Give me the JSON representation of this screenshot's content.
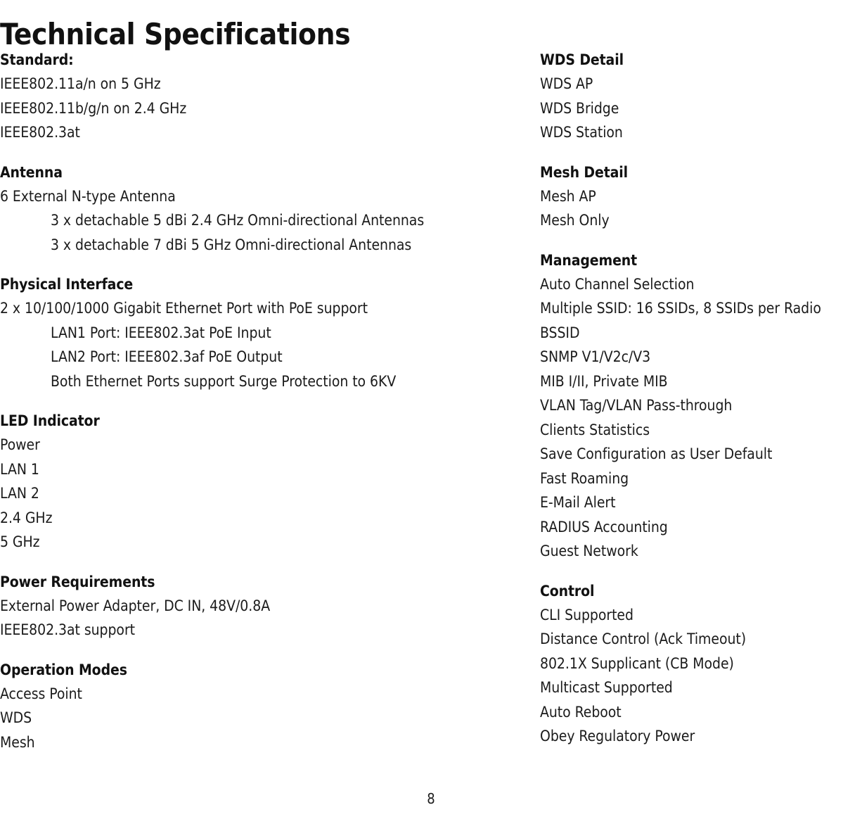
{
  "document": {
    "title": "Technical Specifications",
    "page_number": "8"
  },
  "left_column": {
    "sections": [
      {
        "heading": "Standard:",
        "items": [
          {
            "text": "IEEE802.11a/n on 5 GHz",
            "indent": false
          },
          {
            "text": "IEEE802.11b/g/n on 2.4 GHz",
            "indent": false
          },
          {
            "text": "IEEE802.3at",
            "indent": false
          }
        ]
      },
      {
        "heading": "Antenna",
        "items": [
          {
            "text": "6 External N-type Antenna",
            "indent": false
          },
          {
            "text": "3 x detachable 5 dBi 2.4 GHz Omni-directional Antennas",
            "indent": true
          },
          {
            "text": "3 x detachable 7 dBi 5 GHz Omni-directional Antennas",
            "indent": true
          }
        ]
      },
      {
        "heading": "Physical Interface",
        "items": [
          {
            "text": "2 x 10/100/1000 Gigabit Ethernet Port with PoE support",
            "indent": false
          },
          {
            "text": "LAN1 Port: IEEE802.3at PoE Input",
            "indent": true
          },
          {
            "text": "LAN2 Port: IEEE802.3af PoE Output",
            "indent": true
          },
          {
            "text": "Both Ethernet Ports support Surge Protection to 6KV",
            "indent": true
          }
        ]
      },
      {
        "heading": "LED Indicator",
        "items": [
          {
            "text": "Power",
            "indent": false
          },
          {
            "text": "LAN 1",
            "indent": false
          },
          {
            "text": "LAN 2",
            "indent": false
          },
          {
            "text": "2.4 GHz",
            "indent": false
          },
          {
            "text": "5 GHz",
            "indent": false
          }
        ]
      },
      {
        "heading": "Power Requirements",
        "items": [
          {
            "text": "External Power Adapter, DC IN, 48V/0.8A",
            "indent": false
          },
          {
            "text": "IEEE802.3at support",
            "indent": false
          }
        ]
      },
      {
        "heading": "Operation Modes",
        "items": [
          {
            "text": "Access Point",
            "indent": false
          },
          {
            "text": "WDS",
            "indent": false
          },
          {
            "text": "Mesh",
            "indent": false
          }
        ]
      }
    ]
  },
  "right_column": {
    "sections": [
      {
        "heading": "WDS Detail",
        "items": [
          {
            "text": "WDS AP",
            "indent": false
          },
          {
            "text": "WDS Bridge",
            "indent": false
          },
          {
            "text": "WDS Station",
            "indent": false
          }
        ]
      },
      {
        "heading": "Mesh Detail",
        "items": [
          {
            "text": "Mesh AP",
            "indent": false
          },
          {
            "text": "Mesh Only",
            "indent": false
          }
        ]
      },
      {
        "heading": "Management",
        "items": [
          {
            "text": "Auto Channel Selection",
            "indent": false
          },
          {
            "text": "Multiple SSID: 16 SSIDs, 8 SSIDs per Radio",
            "indent": false
          },
          {
            "text": "BSSID",
            "indent": false
          },
          {
            "text": "SNMP V1/V2c/V3",
            "indent": false
          },
          {
            "text": "MIB I/II, Private MIB",
            "indent": false
          },
          {
            "text": "VLAN Tag/VLAN Pass-through",
            "indent": false
          },
          {
            "text": "Clients Statistics",
            "indent": false
          },
          {
            "text": "Save Configuration as User Default",
            "indent": false
          },
          {
            "text": "Fast Roaming",
            "indent": false
          },
          {
            "text": "E-Mail Alert",
            "indent": false
          },
          {
            "text": "RADIUS Accounting",
            "indent": false
          },
          {
            "text": "Guest Network",
            "indent": false
          }
        ]
      },
      {
        "heading": "Control",
        "items": [
          {
            "text": "CLI Supported",
            "indent": false
          },
          {
            "text": "Distance Control (Ack Timeout)",
            "indent": false
          },
          {
            "text": "802.1X Supplicant (CB Mode)",
            "indent": false
          },
          {
            "text": "Multicast Supported",
            "indent": false
          },
          {
            "text": "Auto Reboot",
            "indent": false
          },
          {
            "text": "Obey Regulatory Power",
            "indent": false
          }
        ]
      }
    ]
  }
}
